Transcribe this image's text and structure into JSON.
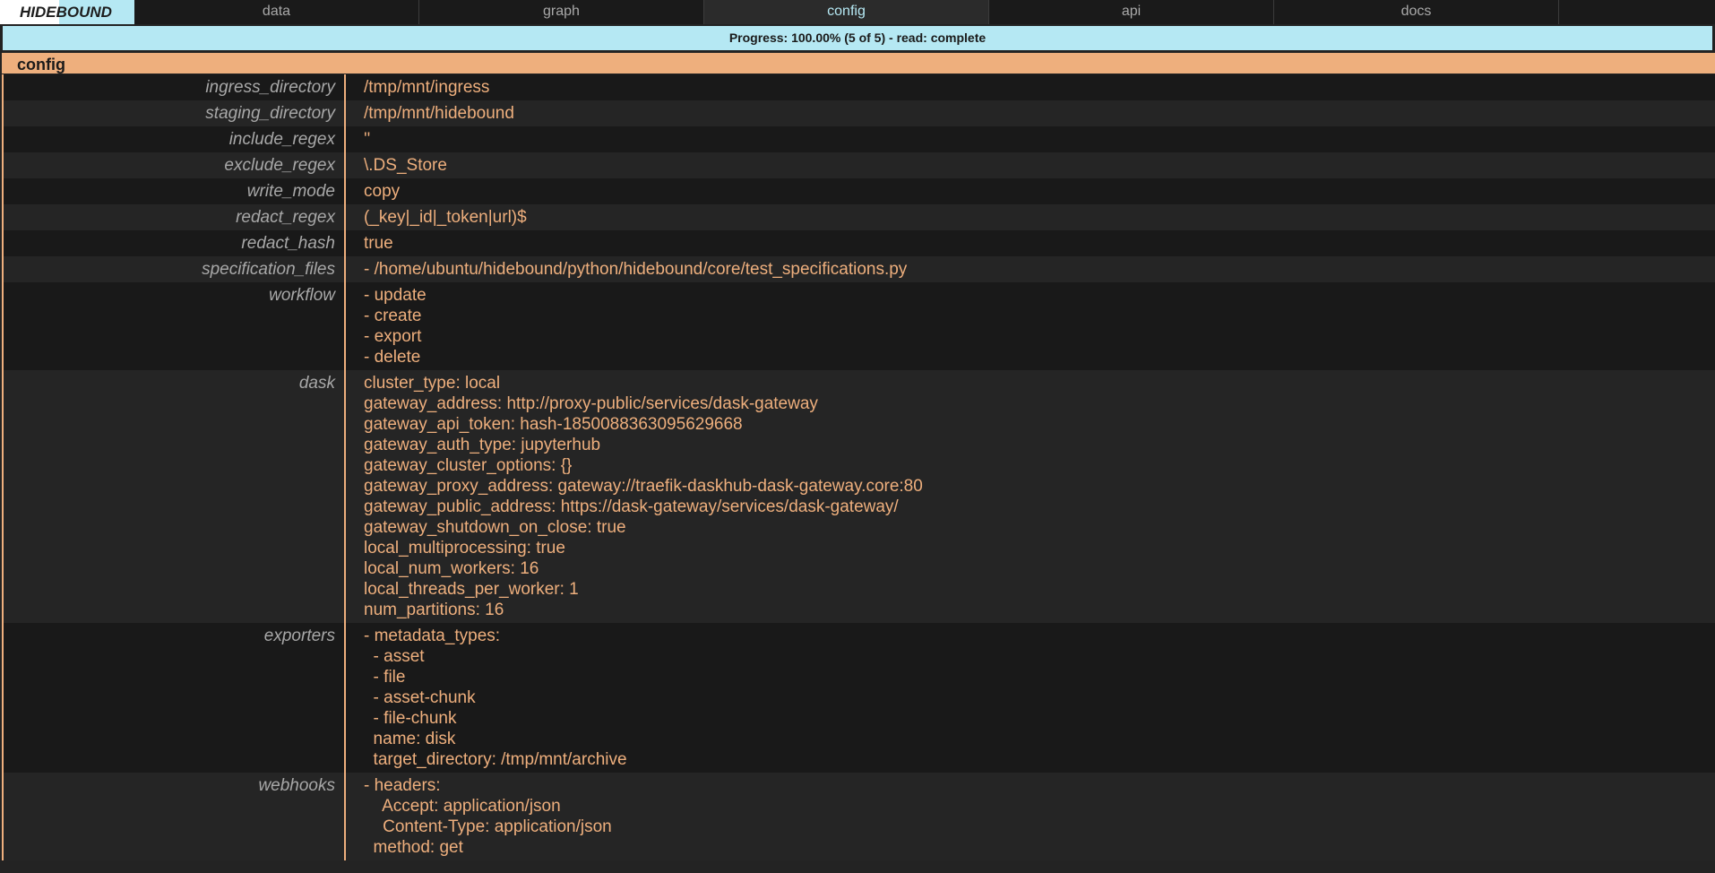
{
  "app": {
    "logo_text": "HIDEBOUND",
    "accent_color": "#b5e8f3",
    "panel_color": "#eeaf7d"
  },
  "nav": {
    "tabs": [
      {
        "label": "data"
      },
      {
        "label": "graph"
      },
      {
        "label": "config"
      },
      {
        "label": "api"
      },
      {
        "label": "docs"
      }
    ],
    "active_tab": "config"
  },
  "progress": {
    "text": "Progress: 100.00% (5 of 5) - read: complete"
  },
  "panel": {
    "title": "config",
    "rows": [
      {
        "key": "ingress_directory",
        "value": "/tmp/mnt/ingress"
      },
      {
        "key": "staging_directory",
        "value": "/tmp/mnt/hidebound"
      },
      {
        "key": "include_regex",
        "value": "''"
      },
      {
        "key": "exclude_regex",
        "value": "\\.DS_Store"
      },
      {
        "key": "write_mode",
        "value": "copy"
      },
      {
        "key": "redact_regex",
        "value": "(_key|_id|_token|url)$"
      },
      {
        "key": "redact_hash",
        "value": "true"
      },
      {
        "key": "specification_files",
        "value": "- /home/ubuntu/hidebound/python/hidebound/core/test_specifications.py"
      },
      {
        "key": "workflow",
        "value": "- update\n- create\n- export\n- delete"
      },
      {
        "key": "dask",
        "value": "cluster_type: local\ngateway_address: http://proxy-public/services/dask-gateway\ngateway_api_token: hash-1850088363095629668\ngateway_auth_type: jupyterhub\ngateway_cluster_options: {}\ngateway_proxy_address: gateway://traefik-daskhub-dask-gateway.core:80\ngateway_public_address: https://dask-gateway/services/dask-gateway/\ngateway_shutdown_on_close: true\nlocal_multiprocessing: true\nlocal_num_workers: 16\nlocal_threads_per_worker: 1\nnum_partitions: 16"
      },
      {
        "key": "exporters",
        "value": "- metadata_types:\n  - asset\n  - file\n  - asset-chunk\n  - file-chunk\n  name: disk\n  target_directory: /tmp/mnt/archive"
      },
      {
        "key": "webhooks",
        "value": "- headers:\n    Accept: application/json\n    Content-Type: application/json\n  method: get"
      }
    ]
  }
}
